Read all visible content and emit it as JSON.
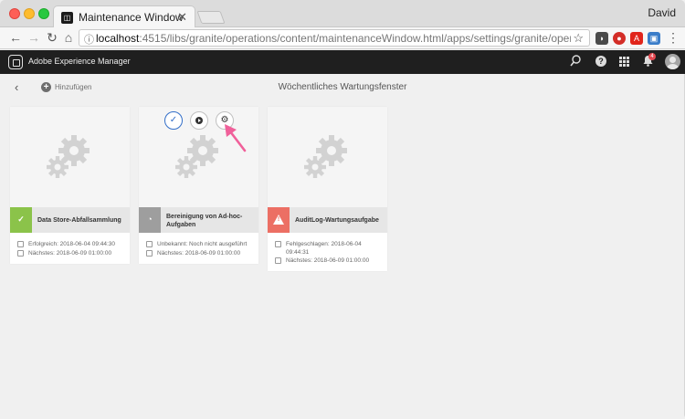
{
  "browser": {
    "tab_title": "Maintenance Window",
    "tab_close": "✕",
    "profile_name": "David",
    "url_host": "localhost",
    "url_rest": ":4515/libs/granite/operations/content/maintenanceWindow.html/apps/settings/granite/operations/mainte…",
    "nav_back": "←",
    "nav_forward": "→",
    "nav_reload": "↻",
    "nav_home": "⌂",
    "star": "☆",
    "menu": "⋮",
    "extensions": [
      {
        "name": "pocket-extension-icon",
        "color": "#4a4a4a",
        "glyph": "◗"
      },
      {
        "name": "lastpass-extension-icon",
        "color": "#d32d27",
        "glyph": "●"
      },
      {
        "name": "adobe-extension-icon",
        "color": "#e1251b",
        "glyph": "A"
      },
      {
        "name": "screenshot-extension-icon",
        "color": "#3a7dc9",
        "glyph": "▣"
      }
    ]
  },
  "aem": {
    "product_name": "Adobe Experience Manager",
    "search_icon": "⚲",
    "help_icon": "?",
    "bell_icon": "🔔",
    "notification_count": "4"
  },
  "actionbar": {
    "back_icon": "‹",
    "add_icon": "+",
    "add_label": "Hinzufügen",
    "page_title": "Wöchentliches Wartungsfenster"
  },
  "quick_actions": {
    "select_icon": "✓",
    "settings_icon": "⚙"
  },
  "cards": [
    {
      "title": "Data Store-Abfallsammlung",
      "status": "success",
      "status_color": "#8bc34a",
      "status_glyph": "✓",
      "rows": [
        "Erfolgreich: 2018-06-04 09:44:30",
        "Nächstes: 2018-06-09 01:00:00"
      ]
    },
    {
      "title": "Bereinigung von Ad-hoc-Aufgaben",
      "status": "unknown",
      "status_color": "#9e9e9e",
      "status_glyph": "◔",
      "rows": [
        "Unbekannt: Noch nicht ausgeführt",
        "Nächstes: 2018-06-09 01:00:00"
      ]
    },
    {
      "title": "AuditLog-Wartungsaufgabe",
      "status": "failed",
      "status_color": "#ec6f64",
      "status_glyph": "!",
      "rows": [
        "Fehlgeschlagen: 2018-06-04 09:44:31",
        "Nächstes: 2018-06-09 01:00:00"
      ]
    }
  ],
  "annotation": {
    "arrow_color": "#f0609a"
  }
}
